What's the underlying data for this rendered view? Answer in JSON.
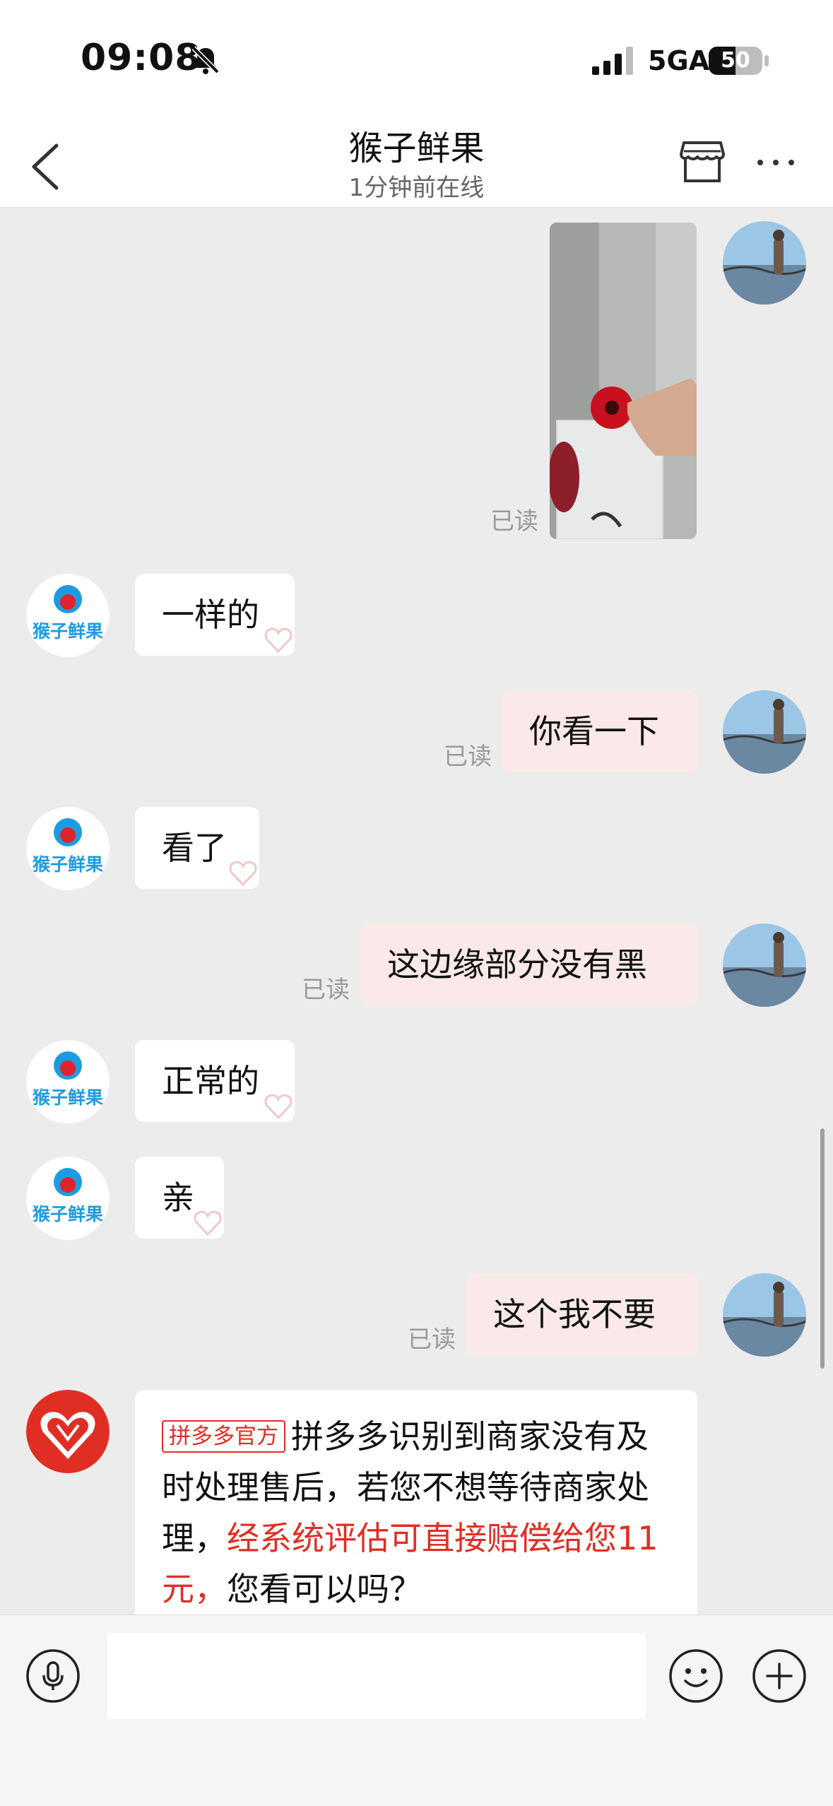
{
  "status_bar": {
    "time": "09:08",
    "network": "5GA",
    "battery": "50",
    "battery_level": 0.5,
    "icons": [
      "bell-slash-icon",
      "signal-icon",
      "battery-icon"
    ]
  },
  "header": {
    "title": "猴子鲜果",
    "subtitle": "1分钟前在线",
    "icons": [
      "back-arrow-icon",
      "store-icon",
      "more-dots-icon"
    ]
  },
  "merchant": {
    "avatar_text": "猴子鲜果",
    "avatar_color": "#1e9be0"
  },
  "read_label": "已读",
  "messages": [
    {
      "sender": "user",
      "type": "image"
    },
    {
      "sender": "merchant",
      "type": "text",
      "text": "一样的"
    },
    {
      "sender": "user",
      "type": "text",
      "text": "你看一下"
    },
    {
      "sender": "merchant",
      "type": "text",
      "text": "看了"
    },
    {
      "sender": "user",
      "type": "text",
      "text": "这边缘部分没有黑"
    },
    {
      "sender": "merchant",
      "type": "text",
      "text": "正常的"
    },
    {
      "sender": "merchant",
      "type": "text",
      "text": "亲"
    },
    {
      "sender": "user",
      "type": "text",
      "text": "这个我不要"
    }
  ],
  "official_message": {
    "tag": "拼多多官方",
    "text_part1": "拼多多识别到商家没有及时处理售后，若您不想等待商家处理，",
    "text_highlight": "经系统评估可直接赔偿给您11元，",
    "text_part2": "您看可以吗？",
    "highlight_color": "#e02e24"
  },
  "input_bar": {
    "placeholder": "",
    "icons": [
      "microphone-icon",
      "emoji-icon",
      "plus-icon"
    ]
  },
  "colors": {
    "chat_background": "#ececec",
    "outgoing_bubble": "#fbe9e9",
    "incoming_bubble": "#ffffff",
    "brand_red": "#e02e24"
  }
}
